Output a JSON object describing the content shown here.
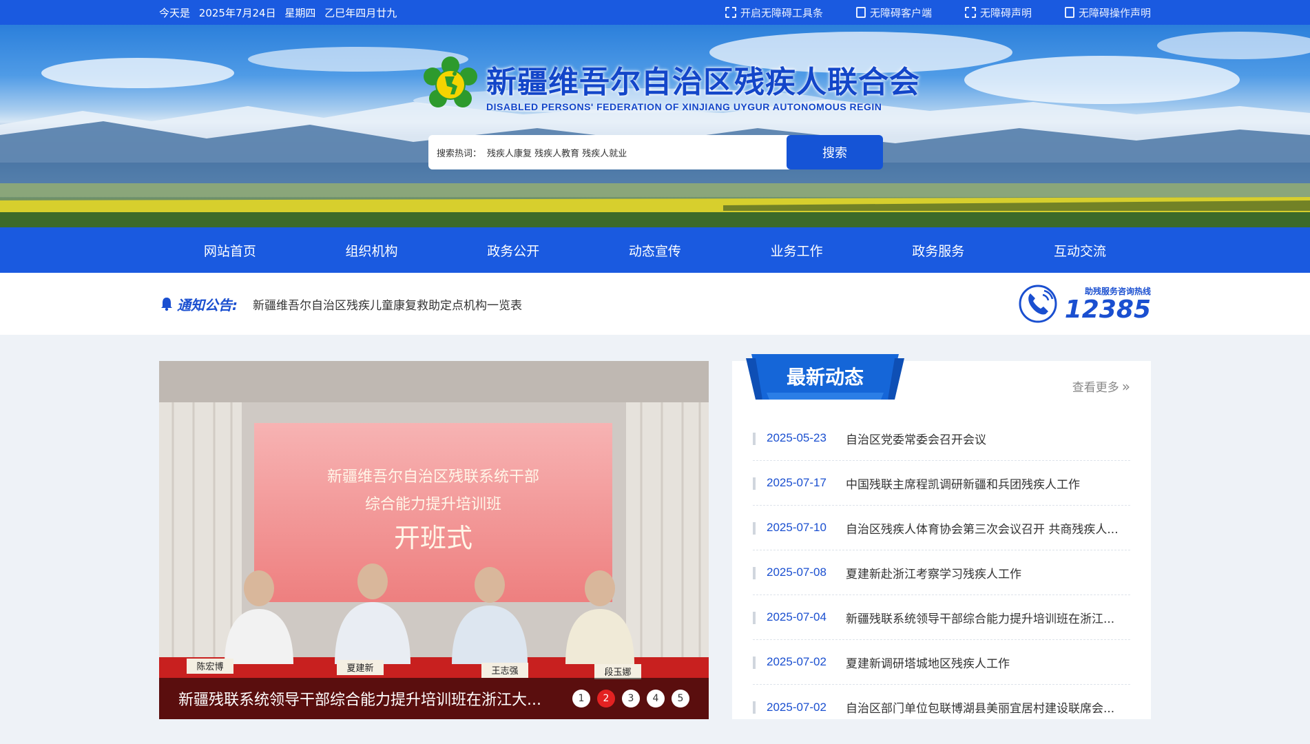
{
  "topbar": {
    "date_prefix": "今天是",
    "date": "2025年7月24日",
    "weekday": "星期四",
    "lunar": "乙巳年四月廿九",
    "links": [
      {
        "label": "开启无障碍工具条",
        "icon": "accessibility-scan-icon"
      },
      {
        "label": "无障碍客户端",
        "icon": "mobile-icon"
      },
      {
        "label": "无障碍声明",
        "icon": "accessibility-scan-icon"
      },
      {
        "label": "无障碍操作声明",
        "icon": "mobile-icon"
      }
    ]
  },
  "header": {
    "title_cn": "新疆维吾尔自治区残疾人联合会",
    "title_en": "DISABLED PERSONS' FEDERATION OF XINJIANG UYGUR AUTONOMOUS REGIN",
    "logo_icon": "federation-emblem-icon",
    "logo_color": "#2d9a2d"
  },
  "search": {
    "hot_label": "搜索热词：",
    "hot_words": "残疾人康复 残疾人教育 残疾人就业",
    "button_label": "搜索"
  },
  "nav": {
    "items": [
      "网站首页",
      "组织机构",
      "政务公开",
      "动态宣传",
      "业务工作",
      "政务服务",
      "互动交流"
    ]
  },
  "notice": {
    "label": "通知公告:",
    "text": "新疆维吾尔自治区残疾儿童康复救助定点机构一览表",
    "icon": "bell-icon"
  },
  "hotline": {
    "title": "助残服务咨询热线",
    "number": "12385",
    "icon": "phone-icon"
  },
  "slider": {
    "caption": "新疆残联系统领导干部综合能力提升培训班在浙江大...",
    "screen_line1": "新疆维吾尔自治区残联系统干部",
    "screen_line2": "综合能力提升培训班",
    "screen_line3": "开班式",
    "nameplates": [
      "陈宏博",
      "夏建新",
      "王志强",
      "段玉娜"
    ],
    "dots": [
      "1",
      "2",
      "3",
      "4",
      "5"
    ],
    "active_dot": "2",
    "active_color": "#e32222"
  },
  "news": {
    "tab_title": "最新动态",
    "more_label": "查看更多",
    "items": [
      {
        "date": "2025-05-23",
        "title": "自治区党委常委会召开会议"
      },
      {
        "date": "2025-07-17",
        "title": "中国残联主席程凯调研新疆和兵团残疾人工作"
      },
      {
        "date": "2025-07-10",
        "title": "自治区残疾人体育协会第三次会议召开 共商残疾人..."
      },
      {
        "date": "2025-07-08",
        "title": "夏建新赴浙江考察学习残疾人工作"
      },
      {
        "date": "2025-07-04",
        "title": "新疆残联系统领导干部综合能力提升培训班在浙江..."
      },
      {
        "date": "2025-07-02",
        "title": "夏建新调研塔城地区残疾人工作"
      },
      {
        "date": "2025-07-02",
        "title": "自治区部门单位包联博湖县美丽宜居村建设联席会..."
      }
    ]
  },
  "colors": {
    "primary": "#1a5ae0",
    "brand_text": "#1346c9",
    "accent_red": "#e32222"
  }
}
